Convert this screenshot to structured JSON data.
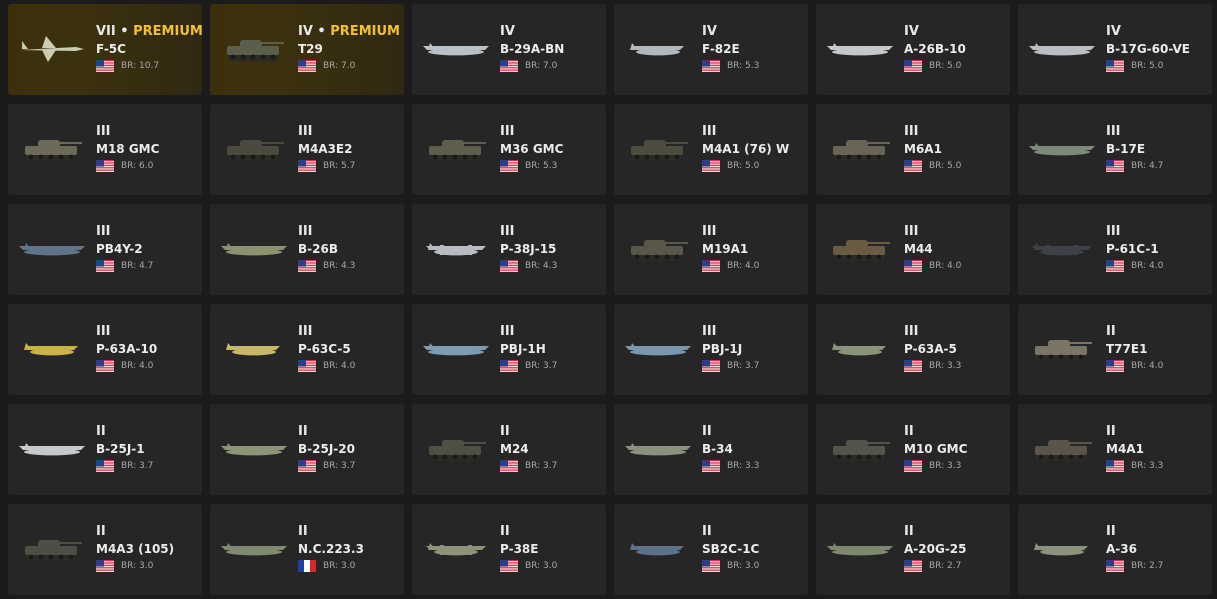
{
  "premium_label": "PREMIUM",
  "vehicles": [
    {
      "rank": "VII",
      "premium": true,
      "name": "F-5C",
      "br": "BR: 10.7",
      "country": "usa",
      "kind": "jet",
      "tone": "#c9cdb3"
    },
    {
      "rank": "IV",
      "premium": true,
      "name": "T29",
      "br": "BR: 7.0",
      "country": "usa",
      "kind": "tank",
      "tone": "#5b5e4a"
    },
    {
      "rank": "IV",
      "premium": false,
      "name": "B-29A-BN",
      "br": "BR: 7.0",
      "country": "usa",
      "kind": "bomber",
      "tone": "#b8c2c8"
    },
    {
      "rank": "IV",
      "premium": false,
      "name": "F-82E",
      "br": "BR: 5.3",
      "country": "usa",
      "kind": "fighter",
      "tone": "#b2b9bf"
    },
    {
      "rank": "IV",
      "premium": false,
      "name": "A-26B-10",
      "br": "BR: 5.0",
      "country": "usa",
      "kind": "bomber",
      "tone": "#c3c8cc"
    },
    {
      "rank": "IV",
      "premium": false,
      "name": "B-17G-60-VE",
      "br": "BR: 5.0",
      "country": "usa",
      "kind": "bomber",
      "tone": "#b9bfc4"
    },
    {
      "rank": "III",
      "premium": false,
      "name": "M18 GMC",
      "br": "BR: 6.0",
      "country": "usa",
      "kind": "tank",
      "tone": "#6d6a59"
    },
    {
      "rank": "III",
      "premium": false,
      "name": "M4A3E2",
      "br": "BR: 5.7",
      "country": "usa",
      "kind": "tank",
      "tone": "#4c4a3e"
    },
    {
      "rank": "III",
      "premium": false,
      "name": "M36 GMC",
      "br": "BR: 5.3",
      "country": "usa",
      "kind": "tank",
      "tone": "#5f5d4c"
    },
    {
      "rank": "III",
      "premium": false,
      "name": "M4A1 (76) W",
      "br": "BR: 5.0",
      "country": "usa",
      "kind": "tank",
      "tone": "#4d4c3f"
    },
    {
      "rank": "III",
      "premium": false,
      "name": "M6A1",
      "br": "BR: 5.0",
      "country": "usa",
      "kind": "tank",
      "tone": "#6a6456"
    },
    {
      "rank": "III",
      "premium": false,
      "name": "B-17E",
      "br": "BR: 4.7",
      "country": "usa",
      "kind": "bomber",
      "tone": "#7d8a7a"
    },
    {
      "rank": "III",
      "premium": false,
      "name": "PB4Y-2",
      "br": "BR: 4.7",
      "country": "usa",
      "kind": "bomber",
      "tone": "#5f7488"
    },
    {
      "rank": "III",
      "premium": false,
      "name": "B-26B",
      "br": "BR: 4.3",
      "country": "usa",
      "kind": "bomber",
      "tone": "#8a9270"
    },
    {
      "rank": "III",
      "premium": false,
      "name": "P-38J-15",
      "br": "BR: 4.3",
      "country": "usa",
      "kind": "twin",
      "tone": "#b6bcc1"
    },
    {
      "rank": "III",
      "premium": false,
      "name": "M19A1",
      "br": "BR: 4.0",
      "country": "usa",
      "kind": "tank",
      "tone": "#58574a"
    },
    {
      "rank": "III",
      "premium": false,
      "name": "M44",
      "br": "BR: 4.0",
      "country": "usa",
      "kind": "tank",
      "tone": "#6a5c43"
    },
    {
      "rank": "III",
      "premium": false,
      "name": "P-61C-1",
      "br": "BR: 4.0",
      "country": "usa",
      "kind": "twin",
      "tone": "#3c4248"
    },
    {
      "rank": "III",
      "premium": false,
      "name": "P-63A-10",
      "br": "BR: 4.0",
      "country": "usa",
      "kind": "fighter",
      "tone": "#c9b545"
    },
    {
      "rank": "III",
      "premium": false,
      "name": "P-63C-5",
      "br": "BR: 4.0",
      "country": "usa",
      "kind": "fighter",
      "tone": "#c8b86a"
    },
    {
      "rank": "III",
      "premium": false,
      "name": "PBJ-1H",
      "br": "BR: 3.7",
      "country": "usa",
      "kind": "bomber",
      "tone": "#7f9bb3"
    },
    {
      "rank": "III",
      "premium": false,
      "name": "PBJ-1J",
      "br": "BR: 3.7",
      "country": "usa",
      "kind": "bomber",
      "tone": "#7c97ad"
    },
    {
      "rank": "III",
      "premium": false,
      "name": "P-63A-5",
      "br": "BR: 3.3",
      "country": "usa",
      "kind": "fighter",
      "tone": "#8a947c"
    },
    {
      "rank": "II",
      "premium": false,
      "name": "T77E1",
      "br": "BR: 4.0",
      "country": "usa",
      "kind": "tank",
      "tone": "#7a7565"
    },
    {
      "rank": "II",
      "premium": false,
      "name": "B-25J-1",
      "br": "BR: 3.7",
      "country": "usa",
      "kind": "bomber",
      "tone": "#c5c9cb"
    },
    {
      "rank": "II",
      "premium": false,
      "name": "B-25J-20",
      "br": "BR: 3.7",
      "country": "usa",
      "kind": "bomber",
      "tone": "#8d9578"
    },
    {
      "rank": "II",
      "premium": false,
      "name": "M24",
      "br": "BR: 3.7",
      "country": "usa",
      "kind": "tank",
      "tone": "#4f4f44"
    },
    {
      "rank": "II",
      "premium": false,
      "name": "B-34",
      "br": "BR: 3.3",
      "country": "usa",
      "kind": "bomber",
      "tone": "#8a927c"
    },
    {
      "rank": "II",
      "premium": false,
      "name": "M10 GMC",
      "br": "BR: 3.3",
      "country": "usa",
      "kind": "tank",
      "tone": "#55544a"
    },
    {
      "rank": "II",
      "premium": false,
      "name": "M4A1",
      "br": "BR: 3.3",
      "country": "usa",
      "kind": "tank",
      "tone": "#5a5548"
    },
    {
      "rank": "II",
      "premium": false,
      "name": "M4A3 (105)",
      "br": "BR: 3.0",
      "country": "usa",
      "kind": "tank",
      "tone": "#4f4e44"
    },
    {
      "rank": "II",
      "premium": false,
      "name": "N.C.223.3",
      "br": "BR: 3.0",
      "country": "france",
      "kind": "bomber",
      "tone": "#7f8a72"
    },
    {
      "rank": "II",
      "premium": false,
      "name": "P-38E",
      "br": "BR: 3.0",
      "country": "usa",
      "kind": "twin",
      "tone": "#8c9378"
    },
    {
      "rank": "II",
      "premium": false,
      "name": "SB2C-1C",
      "br": "BR: 3.0",
      "country": "usa",
      "kind": "fighter",
      "tone": "#5d7288"
    },
    {
      "rank": "II",
      "premium": false,
      "name": "A-20G-25",
      "br": "BR: 2.7",
      "country": "usa",
      "kind": "bomber",
      "tone": "#7e876f"
    },
    {
      "rank": "II",
      "premium": false,
      "name": "A-36",
      "br": "BR: 2.7",
      "country": "usa",
      "kind": "fighter",
      "tone": "#8b927d"
    }
  ]
}
